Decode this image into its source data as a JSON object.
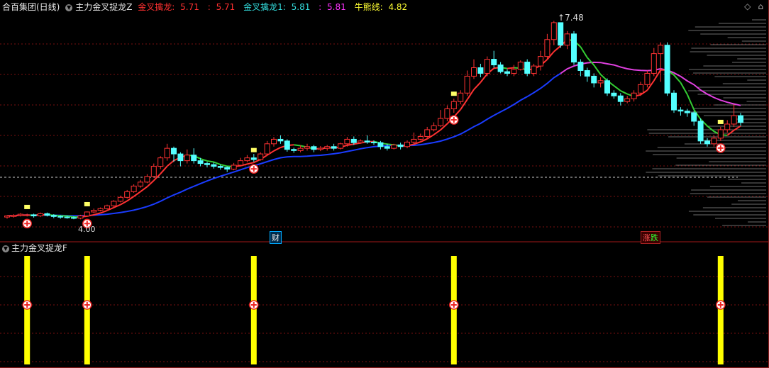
{
  "header": {
    "stock_title": "合百集团(日线)",
    "indicator_name": "主力金叉捉龙Z",
    "items": [
      {
        "label": "金叉擒龙:",
        "value": "5.71",
        "color": "#ff3030"
      },
      {
        "label": ":",
        "value": "5.71",
        "color": "#ff3030"
      },
      {
        "label": "金叉擒龙1:",
        "value": "5.81",
        "color": "#33dddd"
      },
      {
        "label": ":",
        "value": "5.81",
        "color": "#ff33ff"
      },
      {
        "label": "牛熊线:",
        "value": "4.82",
        "color": "#ffff33"
      }
    ]
  },
  "top_right_icons": [
    "diamond-icon",
    "expand-icon"
  ],
  "annotations": {
    "high_price": "7.48",
    "low_price": "4.00",
    "tag_cai": "财",
    "tag_zhang": "涨",
    "tag_die": "跌"
  },
  "sub_panel": {
    "title": "主力金叉捉龙F"
  },
  "colors": {
    "up": "#ff3232",
    "down": "#54ffff",
    "ma_blue": "#1a3cff",
    "ma_magenta": "#e040e0",
    "ma_green": "#33cc33",
    "grid": "#7a1010",
    "signal_bar": "#ffff00",
    "white_mark": "#ffff66"
  },
  "chart_data": {
    "type": "candlestick",
    "price_range": [
      3.8,
      7.6
    ],
    "candles": [
      [
        4.0,
        4.02,
        4.03,
        3.97
      ],
      [
        4.01,
        4.03,
        4.05,
        3.99
      ],
      [
        4.03,
        4.05,
        4.07,
        4.01
      ],
      [
        4.04,
        4.04,
        4.06,
        4.01
      ],
      [
        4.04,
        4.02,
        4.06,
        3.99
      ],
      [
        4.02,
        4.06,
        4.08,
        4.0
      ],
      [
        4.06,
        4.03,
        4.08,
        4.01
      ],
      [
        4.03,
        4.01,
        4.05,
        3.98
      ],
      [
        4.01,
        4.0,
        4.03,
        3.97
      ],
      [
        4.0,
        3.99,
        4.02,
        3.97
      ],
      [
        3.99,
        3.98,
        4.01,
        3.96
      ],
      [
        3.98,
        4.02,
        4.04,
        3.96
      ],
      [
        4.02,
        4.09,
        4.1,
        4.01
      ],
      [
        4.09,
        4.12,
        4.15,
        4.07
      ],
      [
        4.12,
        4.15,
        4.17,
        4.1
      ],
      [
        4.15,
        4.2,
        4.22,
        4.13
      ],
      [
        4.2,
        4.28,
        4.3,
        4.18
      ],
      [
        4.28,
        4.35,
        4.38,
        4.26
      ],
      [
        4.35,
        4.45,
        4.48,
        4.33
      ],
      [
        4.45,
        4.55,
        4.58,
        4.43
      ],
      [
        4.55,
        4.62,
        4.66,
        4.52
      ],
      [
        4.62,
        4.72,
        4.76,
        4.6
      ],
      [
        4.72,
        4.9,
        4.95,
        4.7
      ],
      [
        4.9,
        5.05,
        5.08,
        4.85
      ],
      [
        5.05,
        5.22,
        5.3,
        5.0
      ],
      [
        5.22,
        5.12,
        5.25,
        4.98
      ],
      [
        5.12,
        5.0,
        5.15,
        4.9
      ],
      [
        5.0,
        5.1,
        5.2,
        4.95
      ],
      [
        5.1,
        5.0,
        5.22,
        4.95
      ],
      [
        5.0,
        4.95,
        5.05,
        4.9
      ],
      [
        4.95,
        4.93,
        4.98,
        4.88
      ],
      [
        4.93,
        4.9,
        4.97,
        4.86
      ],
      [
        4.9,
        4.88,
        4.93,
        4.84
      ],
      [
        4.88,
        4.85,
        4.9,
        4.8
      ],
      [
        4.85,
        4.92,
        4.96,
        4.83
      ],
      [
        4.92,
        5.0,
        5.05,
        4.9
      ],
      [
        5.0,
        5.05,
        5.1,
        4.97
      ],
      [
        5.05,
        5.02,
        5.12,
        4.98
      ],
      [
        5.02,
        5.12,
        5.15,
        5.0
      ],
      [
        5.12,
        5.3,
        5.35,
        5.1
      ],
      [
        5.3,
        5.38,
        5.42,
        5.25
      ],
      [
        5.38,
        5.35,
        5.45,
        5.3
      ],
      [
        5.35,
        5.2,
        5.38,
        5.16
      ],
      [
        5.2,
        5.18,
        5.23,
        5.14
      ],
      [
        5.18,
        5.22,
        5.27,
        5.15
      ],
      [
        5.22,
        5.25,
        5.3,
        5.18
      ],
      [
        5.25,
        5.2,
        5.28,
        5.15
      ],
      [
        5.2,
        5.22,
        5.26,
        5.17
      ],
      [
        5.22,
        5.25,
        5.28,
        5.18
      ],
      [
        5.25,
        5.22,
        5.3,
        5.18
      ],
      [
        5.22,
        5.3,
        5.32,
        5.2
      ],
      [
        5.3,
        5.38,
        5.42,
        5.25
      ],
      [
        5.38,
        5.32,
        5.43,
        5.28
      ],
      [
        5.32,
        5.35,
        5.38,
        5.3
      ],
      [
        5.35,
        5.33,
        5.45,
        5.3
      ],
      [
        5.33,
        5.32,
        5.36,
        5.28
      ],
      [
        5.32,
        5.25,
        5.35,
        5.2
      ],
      [
        5.25,
        5.22,
        5.3,
        5.18
      ],
      [
        5.22,
        5.28,
        5.3,
        5.2
      ],
      [
        5.28,
        5.25,
        5.32,
        5.2
      ],
      [
        5.25,
        5.33,
        5.36,
        5.22
      ],
      [
        5.33,
        5.38,
        5.5,
        5.3
      ],
      [
        5.38,
        5.43,
        5.48,
        5.36
      ],
      [
        5.43,
        5.55,
        5.6,
        5.4
      ],
      [
        5.55,
        5.62,
        5.68,
        5.52
      ],
      [
        5.62,
        5.75,
        5.9,
        5.6
      ],
      [
        5.75,
        5.92,
        5.98,
        5.7
      ],
      [
        5.92,
        6.05,
        6.1,
        5.85
      ],
      [
        6.05,
        6.2,
        6.25,
        6.0
      ],
      [
        6.2,
        6.5,
        6.6,
        6.15
      ],
      [
        6.5,
        6.65,
        6.8,
        6.45
      ],
      [
        6.65,
        6.55,
        6.72,
        6.48
      ],
      [
        6.55,
        6.8,
        6.85,
        6.5
      ],
      [
        6.8,
        6.7,
        6.95,
        6.65
      ],
      [
        6.7,
        6.58,
        6.75,
        6.55
      ],
      [
        6.58,
        6.55,
        6.62,
        6.5
      ],
      [
        6.55,
        6.62,
        6.7,
        6.5
      ],
      [
        6.62,
        6.75,
        6.78,
        6.6
      ],
      [
        6.75,
        6.55,
        6.8,
        6.5
      ],
      [
        6.55,
        6.68,
        6.72,
        6.5
      ],
      [
        6.68,
        6.85,
        6.95,
        6.6
      ],
      [
        6.85,
        7.15,
        7.25,
        6.8
      ],
      [
        7.15,
        7.45,
        7.48,
        7.05
      ],
      [
        7.45,
        7.05,
        7.45,
        7.0
      ],
      [
        7.05,
        7.25,
        7.3,
        6.98
      ],
      [
        7.25,
        6.75,
        7.3,
        6.7
      ],
      [
        6.75,
        6.6,
        6.8,
        6.5
      ],
      [
        6.6,
        6.5,
        6.65,
        6.4
      ],
      [
        6.5,
        6.38,
        6.55,
        6.3
      ],
      [
        6.38,
        6.42,
        6.48,
        6.3
      ],
      [
        6.42,
        6.2,
        6.46,
        6.15
      ],
      [
        6.2,
        6.15,
        6.25,
        6.1
      ],
      [
        6.15,
        6.05,
        6.2,
        5.98
      ],
      [
        6.05,
        6.1,
        6.15,
        6.02
      ],
      [
        6.1,
        6.2,
        6.25,
        6.05
      ],
      [
        6.2,
        6.35,
        6.4,
        6.15
      ],
      [
        6.35,
        6.55,
        6.6,
        6.3
      ],
      [
        6.55,
        6.9,
        7.0,
        6.5
      ],
      [
        6.9,
        7.05,
        7.1,
        6.4
      ],
      [
        7.05,
        6.2,
        7.1,
        6.15
      ],
      [
        6.2,
        5.9,
        6.25,
        5.85
      ],
      [
        5.9,
        5.88,
        5.95,
        5.8
      ],
      [
        5.88,
        5.85,
        5.92,
        5.78
      ],
      [
        5.85,
        5.7,
        5.88,
        5.62
      ],
      [
        5.7,
        5.35,
        5.75,
        5.3
      ],
      [
        5.35,
        5.3,
        5.4,
        5.25
      ],
      [
        5.3,
        5.4,
        5.45,
        5.25
      ],
      [
        5.4,
        5.55,
        5.6,
        5.35
      ],
      [
        5.55,
        5.65,
        5.72,
        5.5
      ],
      [
        5.65,
        5.8,
        6.0,
        5.6
      ],
      [
        5.8,
        5.68,
        5.85,
        5.62
      ]
    ],
    "buy_signal_indices": [
      3,
      12,
      37,
      67,
      107
    ],
    "signal_level": 5.0
  }
}
